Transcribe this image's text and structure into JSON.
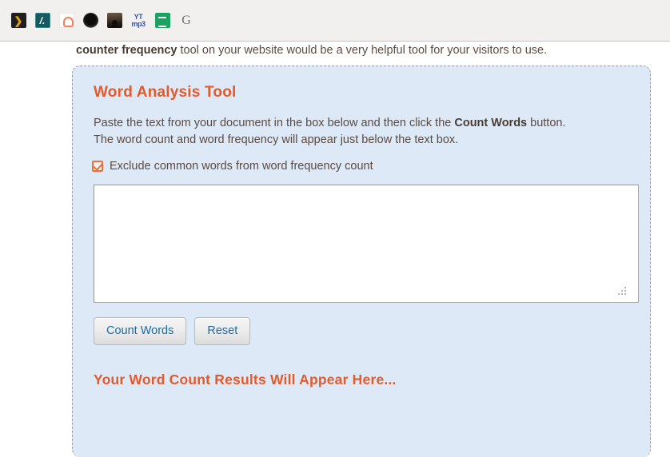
{
  "bookmarks": {
    "items": [
      {
        "name": "plex-icon",
        "label": ""
      },
      {
        "name": "teal-slash-icon",
        "label": ""
      },
      {
        "name": "home-outline-icon",
        "label": ""
      },
      {
        "name": "dark-circle-icon",
        "label": ""
      },
      {
        "name": "photo-thumb-icon",
        "label": ""
      },
      {
        "name": "ytmp3-icon",
        "yt": "YT",
        "mp3": "mp3"
      },
      {
        "name": "google-sheets-icon",
        "label": ""
      },
      {
        "name": "google-g-icon",
        "label": "G"
      }
    ]
  },
  "page": {
    "intro_prefix": "counter frequency",
    "intro_rest": " tool on your website would be a very helpful tool for your visitors to use."
  },
  "tool": {
    "title": "Word Analysis Tool",
    "desc_line1_a": "Paste the text from your document in the box below and then click the ",
    "desc_line1_b": "Count Words",
    "desc_line1_c": " button.",
    "desc_line2": "The word count and word frequency will appear just below the text box.",
    "exclude_label": "Exclude common words from word frequency count",
    "textarea_value": "",
    "textarea_placeholder": "",
    "count_words_label": "Count Words",
    "reset_label": "Reset",
    "results_heading": "Your Word Count Results Will Appear Here..."
  },
  "colors": {
    "accent_orange": "#e35a2b",
    "panel_blue": "#dde9f7",
    "button_text_blue": "#1c6ca1",
    "body_text": "#5a4b42",
    "panel_border": "#9aa0a6"
  }
}
